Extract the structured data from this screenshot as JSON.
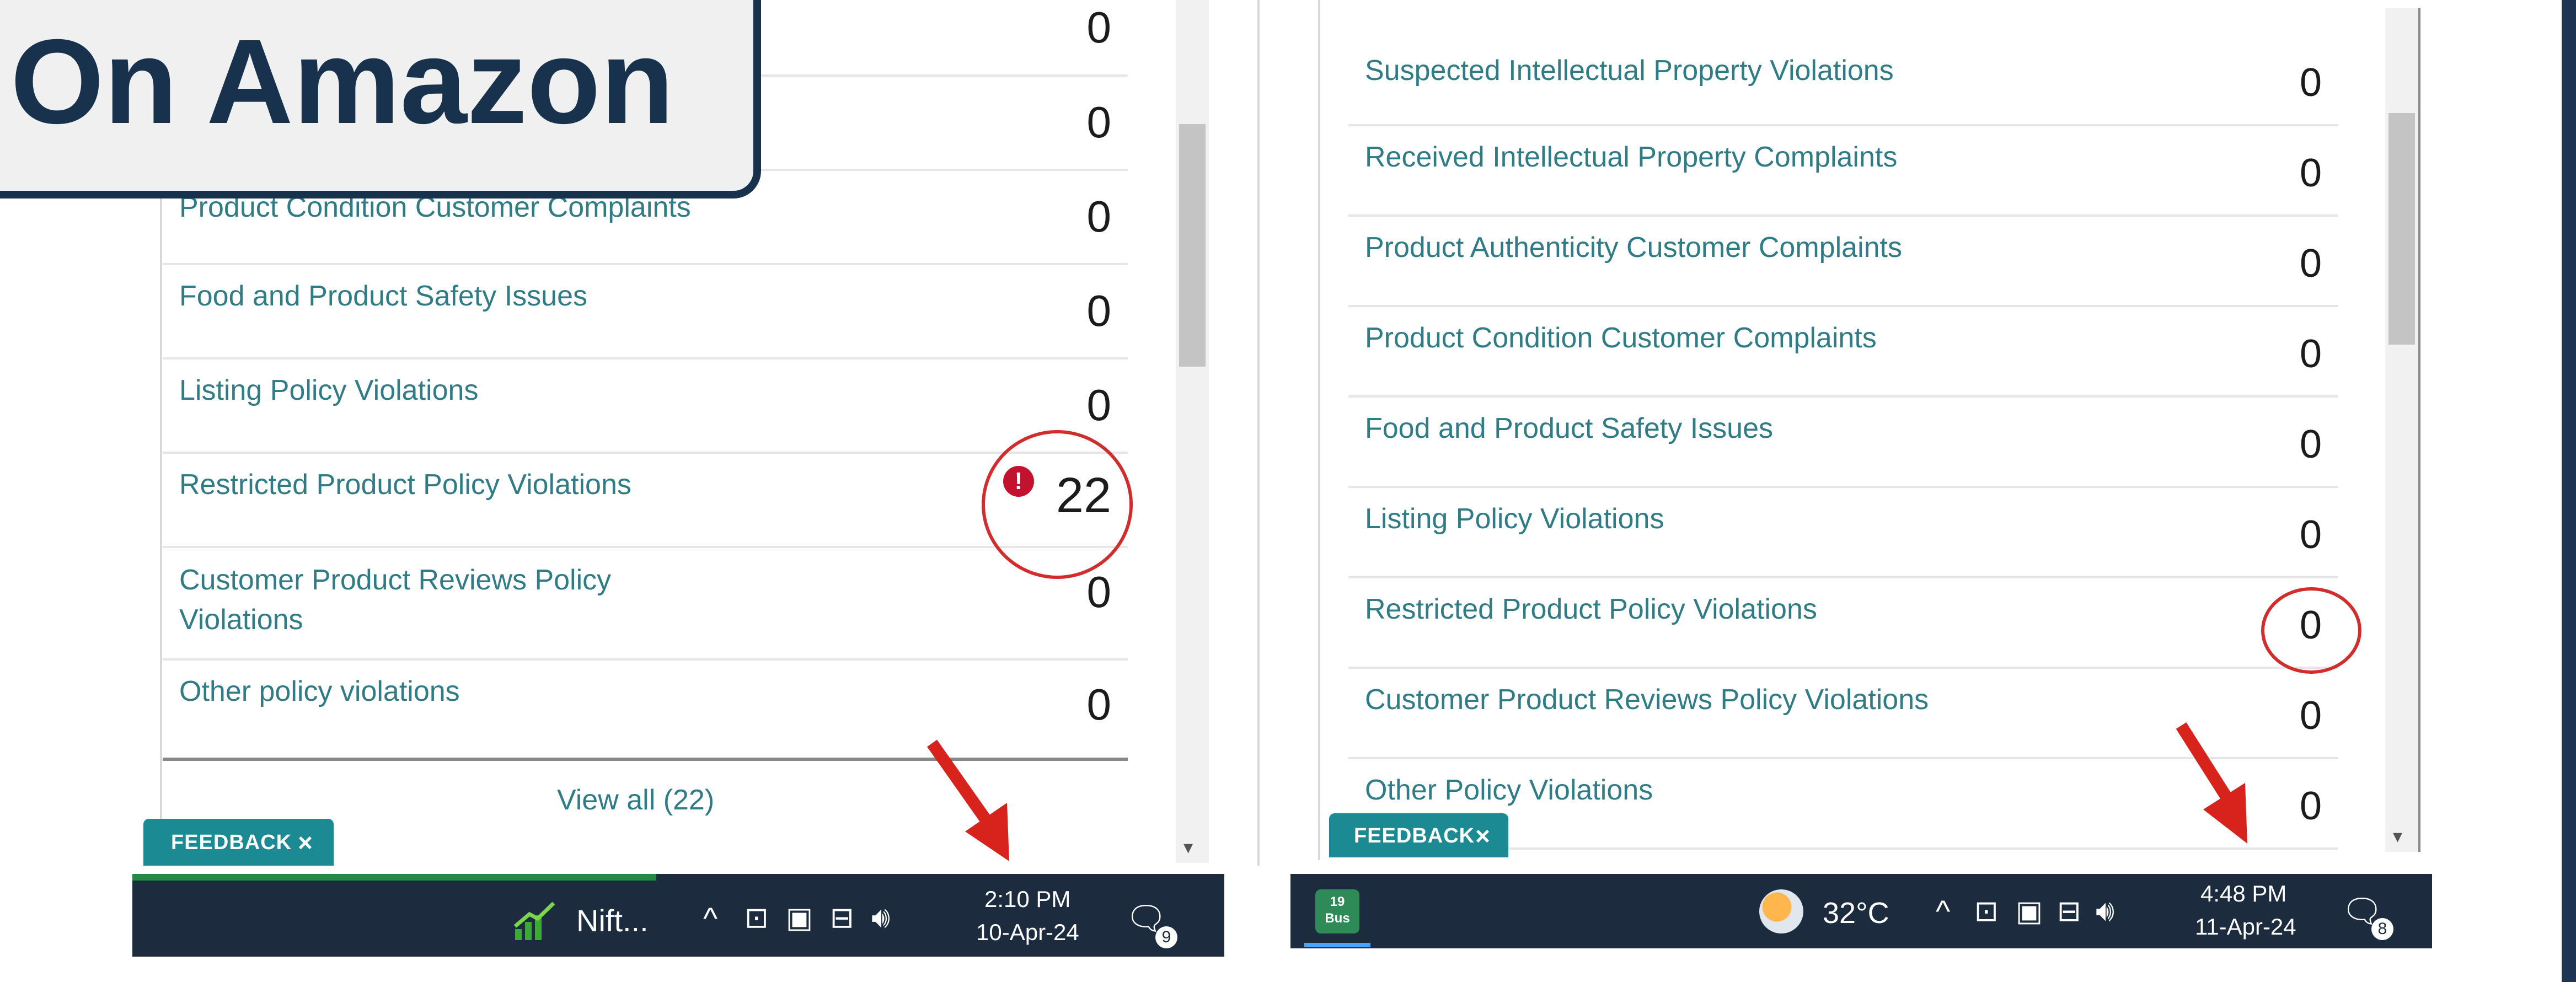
{
  "overlay": {
    "title": "On Amazon"
  },
  "left_panel": {
    "rows": [
      {
        "label": "",
        "value": "0"
      },
      {
        "label": "",
        "value": "0"
      },
      {
        "label": "Product Condition Customer Complaints",
        "value": "0"
      },
      {
        "label": "Food and Product Safety Issues",
        "value": "0"
      },
      {
        "label": "Listing Policy Violations",
        "value": "0"
      },
      {
        "label": "Restricted Product Policy Violations",
        "value": "22"
      },
      {
        "label": "Customer Product Reviews Policy Violations",
        "value": "0"
      },
      {
        "label": "Other policy violations",
        "value": "0"
      }
    ],
    "view_all": "View all (22)",
    "feedback": {
      "label": "FEEDBACK",
      "close": "×"
    },
    "taskbar": {
      "app_label": "Nift...",
      "time": "2:10 PM",
      "date": "10-Apr-24",
      "notification_count": "9"
    }
  },
  "right_panel": {
    "rows": [
      {
        "label": "Suspected Intellectual Property Violations",
        "value": "0"
      },
      {
        "label": "Received Intellectual Property Complaints",
        "value": "0"
      },
      {
        "label": "Product Authenticity Customer Complaints",
        "value": "0"
      },
      {
        "label": "Product Condition Customer Complaints",
        "value": "0"
      },
      {
        "label": "Food and Product Safety Issues",
        "value": "0"
      },
      {
        "label": "Listing Policy Violations",
        "value": "0"
      },
      {
        "label": "Restricted Product Policy Violations",
        "value": "0"
      },
      {
        "label": "Customer Product Reviews Policy Violations",
        "value": "0"
      },
      {
        "label": "Other Policy Violations",
        "value": "0"
      }
    ],
    "feedback": {
      "label": "FEEDBACK",
      "close": "×"
    },
    "taskbar": {
      "app_label": "19\nBus",
      "weather": "32°C",
      "time": "4:48 PM",
      "date": "11-Apr-24",
      "notification_count": "8"
    }
  },
  "colors": {
    "link": "#2f7c86",
    "alert_red": "#d22c2c",
    "taskbar": "#1c2b3d",
    "title_navy": "#18324e",
    "feedback_teal": "#1b8a93"
  }
}
